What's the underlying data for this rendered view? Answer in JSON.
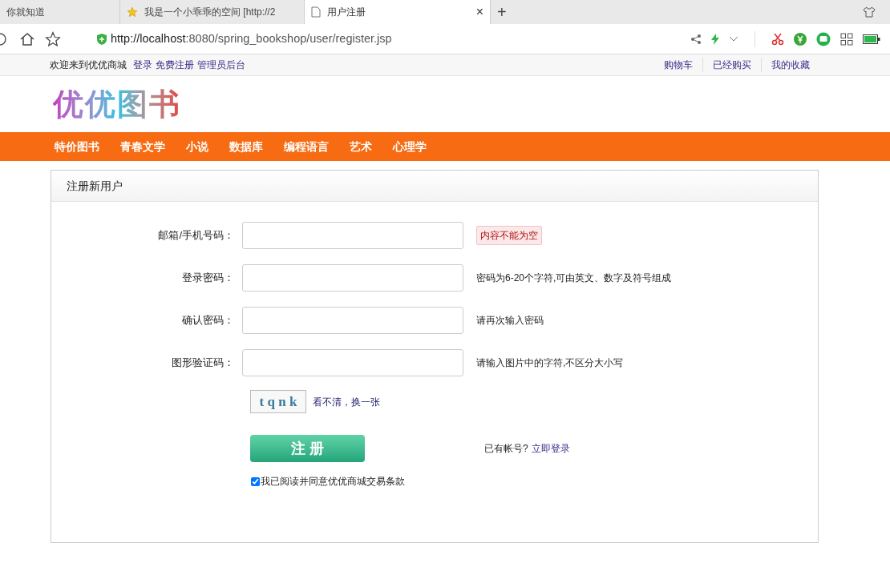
{
  "browser": {
    "tabs": [
      {
        "title": "你就知道",
        "selected": false,
        "kind": "plain"
      },
      {
        "title": "我是一个小乖乖的空间 [http://2",
        "selected": false,
        "kind": "favorite"
      },
      {
        "title": "用户注册",
        "selected": true,
        "kind": "document"
      }
    ],
    "new_tab": "+",
    "close": "×",
    "url_host": "http://localhost",
    "url_rest": ":8080/spring_bookshop/user/register.jsp"
  },
  "topbar": {
    "welcome": "欢迎来到优优商城",
    "links": [
      "登录",
      "免费注册",
      "管理员后台"
    ],
    "right_links": [
      "购物车",
      "已经购买",
      "我的收藏"
    ]
  },
  "logo": "优优图书",
  "nav": [
    "特价图书",
    "青春文学",
    "小说",
    "数据库",
    "编程语言",
    "艺术",
    "心理学"
  ],
  "form": {
    "title": "注册新用户",
    "fields": [
      {
        "label": "邮箱/手机号码：",
        "hint": "内容不能为空",
        "error": true
      },
      {
        "label": "登录密码：",
        "hint": "密码为6-20个字符,可由英文、数字及符号组成",
        "error": false
      },
      {
        "label": "确认密码：",
        "hint": "请再次输入密码",
        "error": false
      },
      {
        "label": "图形验证码：",
        "hint": "请输入图片中的字符,不区分大小写",
        "error": false
      }
    ],
    "captcha": "t q n k",
    "refresh": "看不清，换一张",
    "submit": "注 册",
    "have_account": "已有帐号?",
    "login_link": "立即登录",
    "agree": {
      "label": "我已阅读并同意优优商城交易条款",
      "checked": true
    }
  }
}
